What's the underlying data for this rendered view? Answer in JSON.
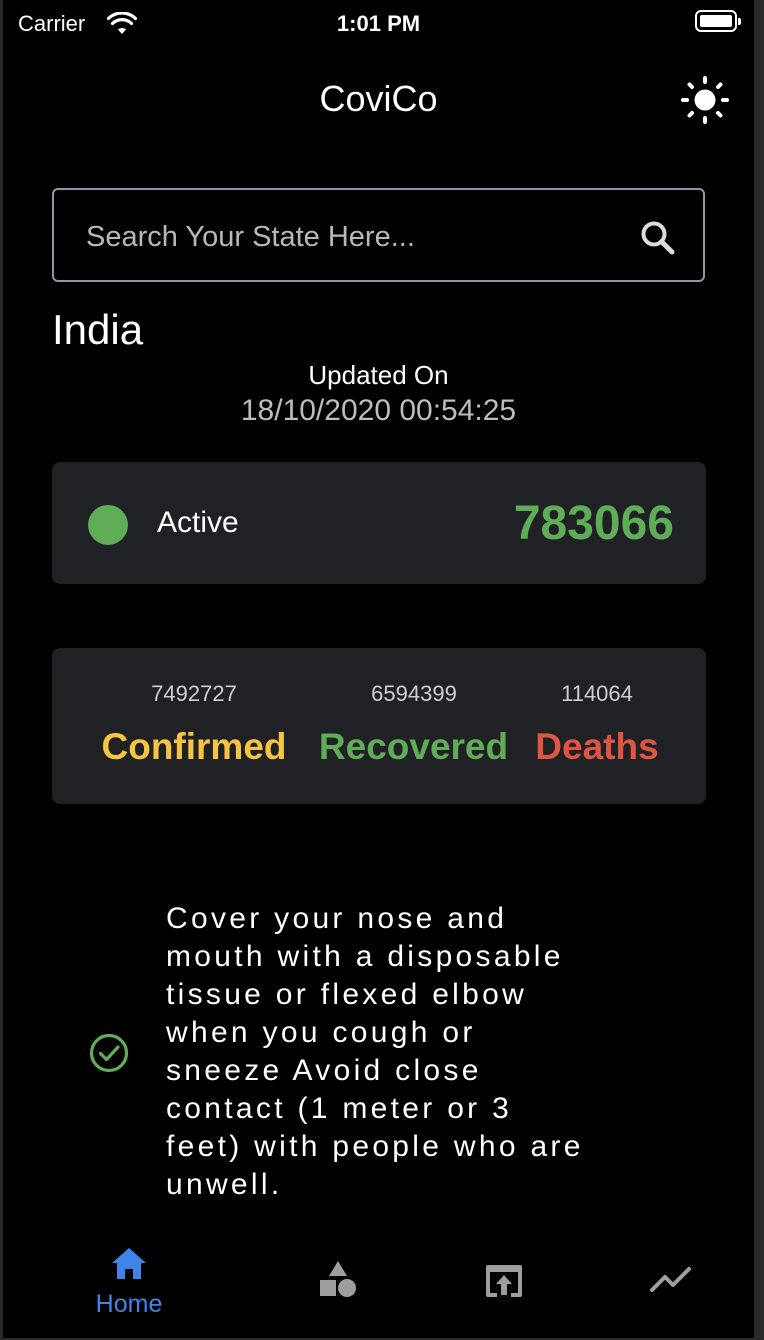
{
  "status_bar": {
    "carrier": "Carrier",
    "time": "1:01 PM"
  },
  "header": {
    "title": "CoviCo",
    "theme_icon": "sun-icon"
  },
  "search": {
    "placeholder": "Search Your State Here...",
    "value": "",
    "icon": "search-icon"
  },
  "region": {
    "name": "India"
  },
  "updated": {
    "label": "Updated On",
    "datetime": "18/10/2020 00:54:25"
  },
  "active": {
    "label": "Active",
    "value": "783066",
    "color": "#5fad56"
  },
  "stats": [
    {
      "value": "7492727",
      "label": "Confirmed",
      "color": "#f6c343"
    },
    {
      "value": "6594399",
      "label": "Recovered",
      "color": "#5fad56"
    },
    {
      "value": "114064",
      "label": "Deaths",
      "color": "#e05443"
    }
  ],
  "tip": {
    "text": "Cover your nose and\nmouth with a disposable\ntissue or flexed elbow\nwhen you cough or\nsneeze Avoid close\ncontact (1 meter or 3\nfeet) with people who are\nunwell.",
    "icon": "check-circle-icon"
  },
  "nav": {
    "items": [
      {
        "label": "Home",
        "icon": "home-icon",
        "active": true
      },
      {
        "label": "",
        "icon": "shapes-icon",
        "active": false
      },
      {
        "label": "",
        "icon": "open-in-browser-icon",
        "active": false
      },
      {
        "label": "",
        "icon": "trending-icon",
        "active": false
      }
    ],
    "active_color": "#3d85e8",
    "inactive_color": "#9e9e9e"
  }
}
